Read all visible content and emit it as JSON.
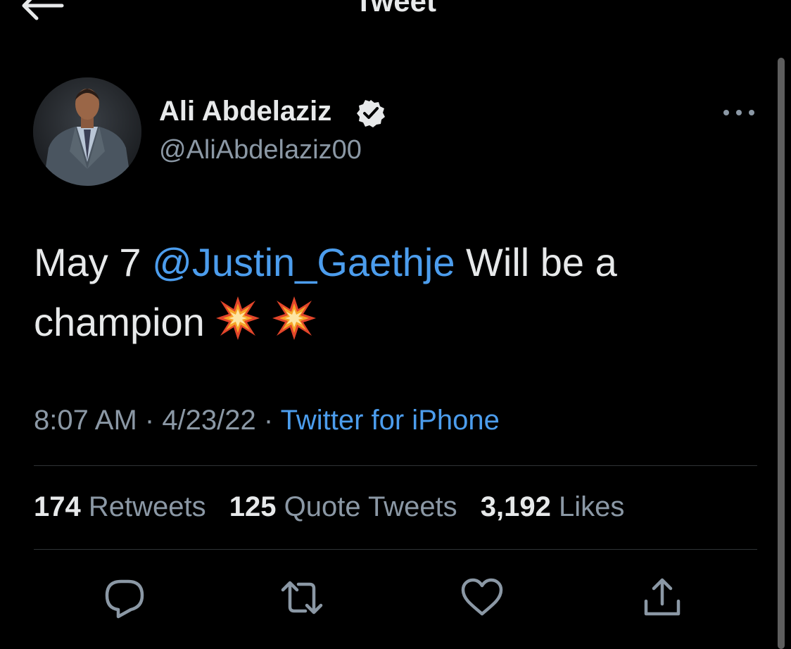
{
  "header": {
    "title": "Tweet"
  },
  "author": {
    "name": "Ali Abdelaziz",
    "handle": "@AliAbdelaziz00",
    "verified": true
  },
  "tweet": {
    "text_before": "May 7 ",
    "mention": "@Justin_Gaethje",
    "text_after": " Will be a champion",
    "emojis": [
      "collision-icon",
      "collision-icon"
    ]
  },
  "meta": {
    "time": "8:07 AM",
    "sep1": " · ",
    "date": "4/23/22",
    "sep2": " · ",
    "source": "Twitter for iPhone"
  },
  "stats": {
    "retweets_count": "174",
    "retweets_label": " Retweets",
    "quotes_count": "125",
    "quotes_label": " Quote Tweets",
    "likes_count": "3,192",
    "likes_label": " Likes"
  },
  "actions": [
    "reply-icon",
    "retweet-icon",
    "like-icon",
    "share-icon"
  ],
  "colors": {
    "background": "#000000",
    "text": "#e7e9ea",
    "secondary": "#8b98a5",
    "link": "#4c9ded",
    "divider": "#2f3336"
  }
}
